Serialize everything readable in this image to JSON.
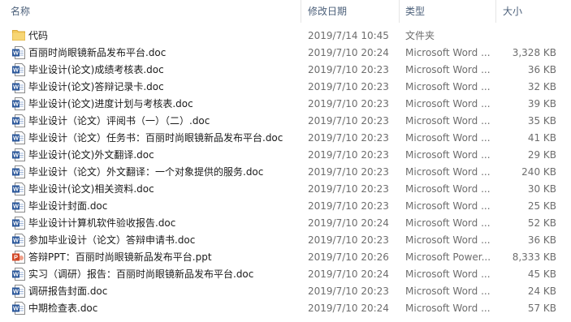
{
  "columns": {
    "name": "名称",
    "date": "修改日期",
    "type": "类型",
    "size": "大小",
    "sort_indicator": "^"
  },
  "colors": {
    "folder": "#f3c95c",
    "word": "#2b579a",
    "ppt": "#d24726",
    "header_text": "#4c607a",
    "detail_text": "#6d6d6d"
  },
  "files": [
    {
      "icon": "folder-icon",
      "name": "代码",
      "date": "2019/7/14 10:45",
      "type": "文件夹",
      "size": ""
    },
    {
      "icon": "word-doc-icon",
      "name": "百丽时尚眼镜新品发布平台.doc",
      "date": "2019/7/10 20:24",
      "type": "Microsoft Word ...",
      "size": "3,328 KB"
    },
    {
      "icon": "word-doc-icon",
      "name": "毕业设计(论文)成绩考核表.doc",
      "date": "2019/7/10 20:23",
      "type": "Microsoft Word ...",
      "size": "36 KB"
    },
    {
      "icon": "word-doc-icon",
      "name": "毕业设计(论文)答辩记录卡.doc",
      "date": "2019/7/10 20:23",
      "type": "Microsoft Word ...",
      "size": "32 KB"
    },
    {
      "icon": "word-doc-icon",
      "name": "毕业设计(论文)进度计划与考核表.doc",
      "date": "2019/7/10 20:23",
      "type": "Microsoft Word ...",
      "size": "39 KB"
    },
    {
      "icon": "word-doc-icon",
      "name": "毕业设计（论文）评阅书（一）（二）.doc",
      "date": "2019/7/10 20:23",
      "type": "Microsoft Word ...",
      "size": "35 KB"
    },
    {
      "icon": "word-doc-icon",
      "name": "毕业设计（论文）任务书：百丽时尚眼镜新品发布平台.doc",
      "date": "2019/7/10 20:23",
      "type": "Microsoft Word ...",
      "size": "41 KB"
    },
    {
      "icon": "word-doc-icon",
      "name": "毕业设计(论文)外文翻译.doc",
      "date": "2019/7/10 20:23",
      "type": "Microsoft Word ...",
      "size": "29 KB"
    },
    {
      "icon": "word-doc-icon",
      "name": "毕业设计（论文）外文翻译：一个对象提供的服务.doc",
      "date": "2019/7/10 20:23",
      "type": "Microsoft Word ...",
      "size": "240 KB"
    },
    {
      "icon": "word-doc-icon",
      "name": "毕业设计(论文)相关资料.doc",
      "date": "2019/7/10 20:23",
      "type": "Microsoft Word ...",
      "size": "30 KB"
    },
    {
      "icon": "word-doc-icon",
      "name": "毕业设计封面.doc",
      "date": "2019/7/10 20:23",
      "type": "Microsoft Word ...",
      "size": "25 KB"
    },
    {
      "icon": "word-doc-icon",
      "name": "毕业设计计算机软件验收报告.doc",
      "date": "2019/7/10 20:24",
      "type": "Microsoft Word ...",
      "size": "52 KB"
    },
    {
      "icon": "word-doc-icon",
      "name": "参加毕业设计（论文）答辩申请书.doc",
      "date": "2019/7/10 20:23",
      "type": "Microsoft Word ...",
      "size": "36 KB"
    },
    {
      "icon": "ppt-icon",
      "name": "答辩PPT：百丽时尚眼镜新品发布平台.ppt",
      "date": "2019/7/10 20:26",
      "type": "Microsoft Power...",
      "size": "8,333 KB"
    },
    {
      "icon": "word-doc-icon",
      "name": "实习（调研）报告：百丽时尚眼镜新品发布平台.doc",
      "date": "2019/7/10 20:24",
      "type": "Microsoft Word ...",
      "size": "45 KB"
    },
    {
      "icon": "word-doc-icon",
      "name": "调研报告封面.doc",
      "date": "2019/7/10 20:23",
      "type": "Microsoft Word ...",
      "size": "24 KB"
    },
    {
      "icon": "word-doc-icon",
      "name": "中期检查表.doc",
      "date": "2019/7/10 20:24",
      "type": "Microsoft Word ...",
      "size": "57 KB"
    }
  ]
}
